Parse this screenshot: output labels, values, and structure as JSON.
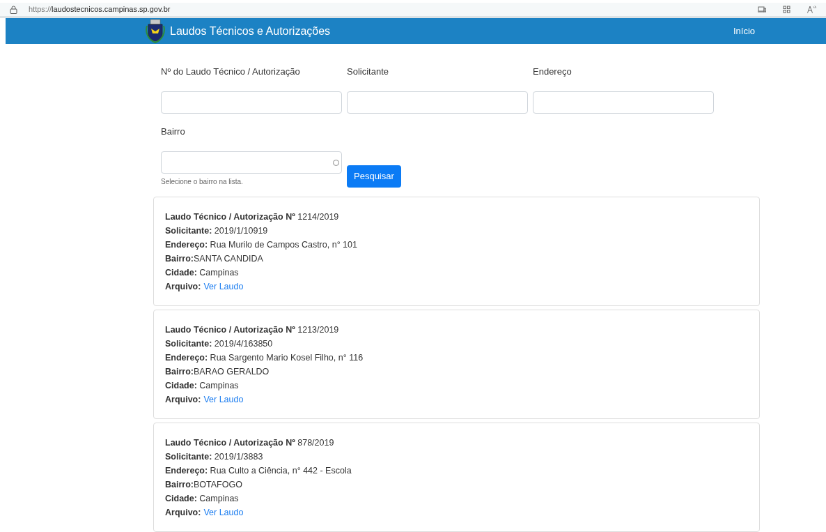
{
  "browser": {
    "url_prefix": "https://",
    "url_host": "laudostecnicos.campinas.sp.gov.br"
  },
  "navbar": {
    "title": "Laudos Técnicos e Autorizações",
    "links": [
      "Início"
    ]
  },
  "search_form": {
    "fields": [
      {
        "label": "Nº do Laudo Técnico / Autorização",
        "kind": "text"
      },
      {
        "label": "Solicitante",
        "kind": "text"
      },
      {
        "label": "Endereço",
        "kind": "text"
      },
      {
        "label": "Bairro",
        "kind": "select",
        "help": "Selecione o bairro na lista."
      }
    ],
    "button": "Pesquisar"
  },
  "results": [
    {
      "lines": [
        {
          "text": "**Laudo Técnico / Autorização Nº** 1214/2019"
        },
        {
          "text": "**Solicitante:** 2019/1/10919"
        },
        {
          "text": "**Endereço:** Rua Murilo de Campos Castro, n° 101"
        },
        {
          "text": "**Bairro:**SANTA CANDIDA"
        },
        {
          "text": "**Cidade:** Campinas"
        },
        {
          "text": "**Arquivo:**",
          "link": "Ver Laudo"
        }
      ]
    },
    {
      "lines": [
        {
          "text": "**Laudo Técnico / Autorização Nº** 1213/2019"
        },
        {
          "text": "**Solicitante:** 2019/4/163850"
        },
        {
          "text": "**Endereço:** Rua Sargento Mario Kosel Filho, n° 116"
        },
        {
          "text": "**Bairro:**BARAO GERALDO"
        },
        {
          "text": "**Cidade:** Campinas"
        },
        {
          "text": "**Arquivo:**",
          "link": "Ver Laudo"
        }
      ]
    },
    {
      "lines": [
        {
          "text": "**Laudo Técnico / Autorização Nº** 878/2019"
        },
        {
          "text": "**Solicitante:** 2019/1/3883"
        },
        {
          "text": "**Endereço:** Rua Culto a Ciência, n° 442 - Escola"
        },
        {
          "text": "**Bairro:**BOTAFOGO"
        },
        {
          "text": "**Cidade:** Campinas"
        },
        {
          "text": "**Arquivo:**",
          "link": "Ver Laudo"
        }
      ]
    }
  ]
}
